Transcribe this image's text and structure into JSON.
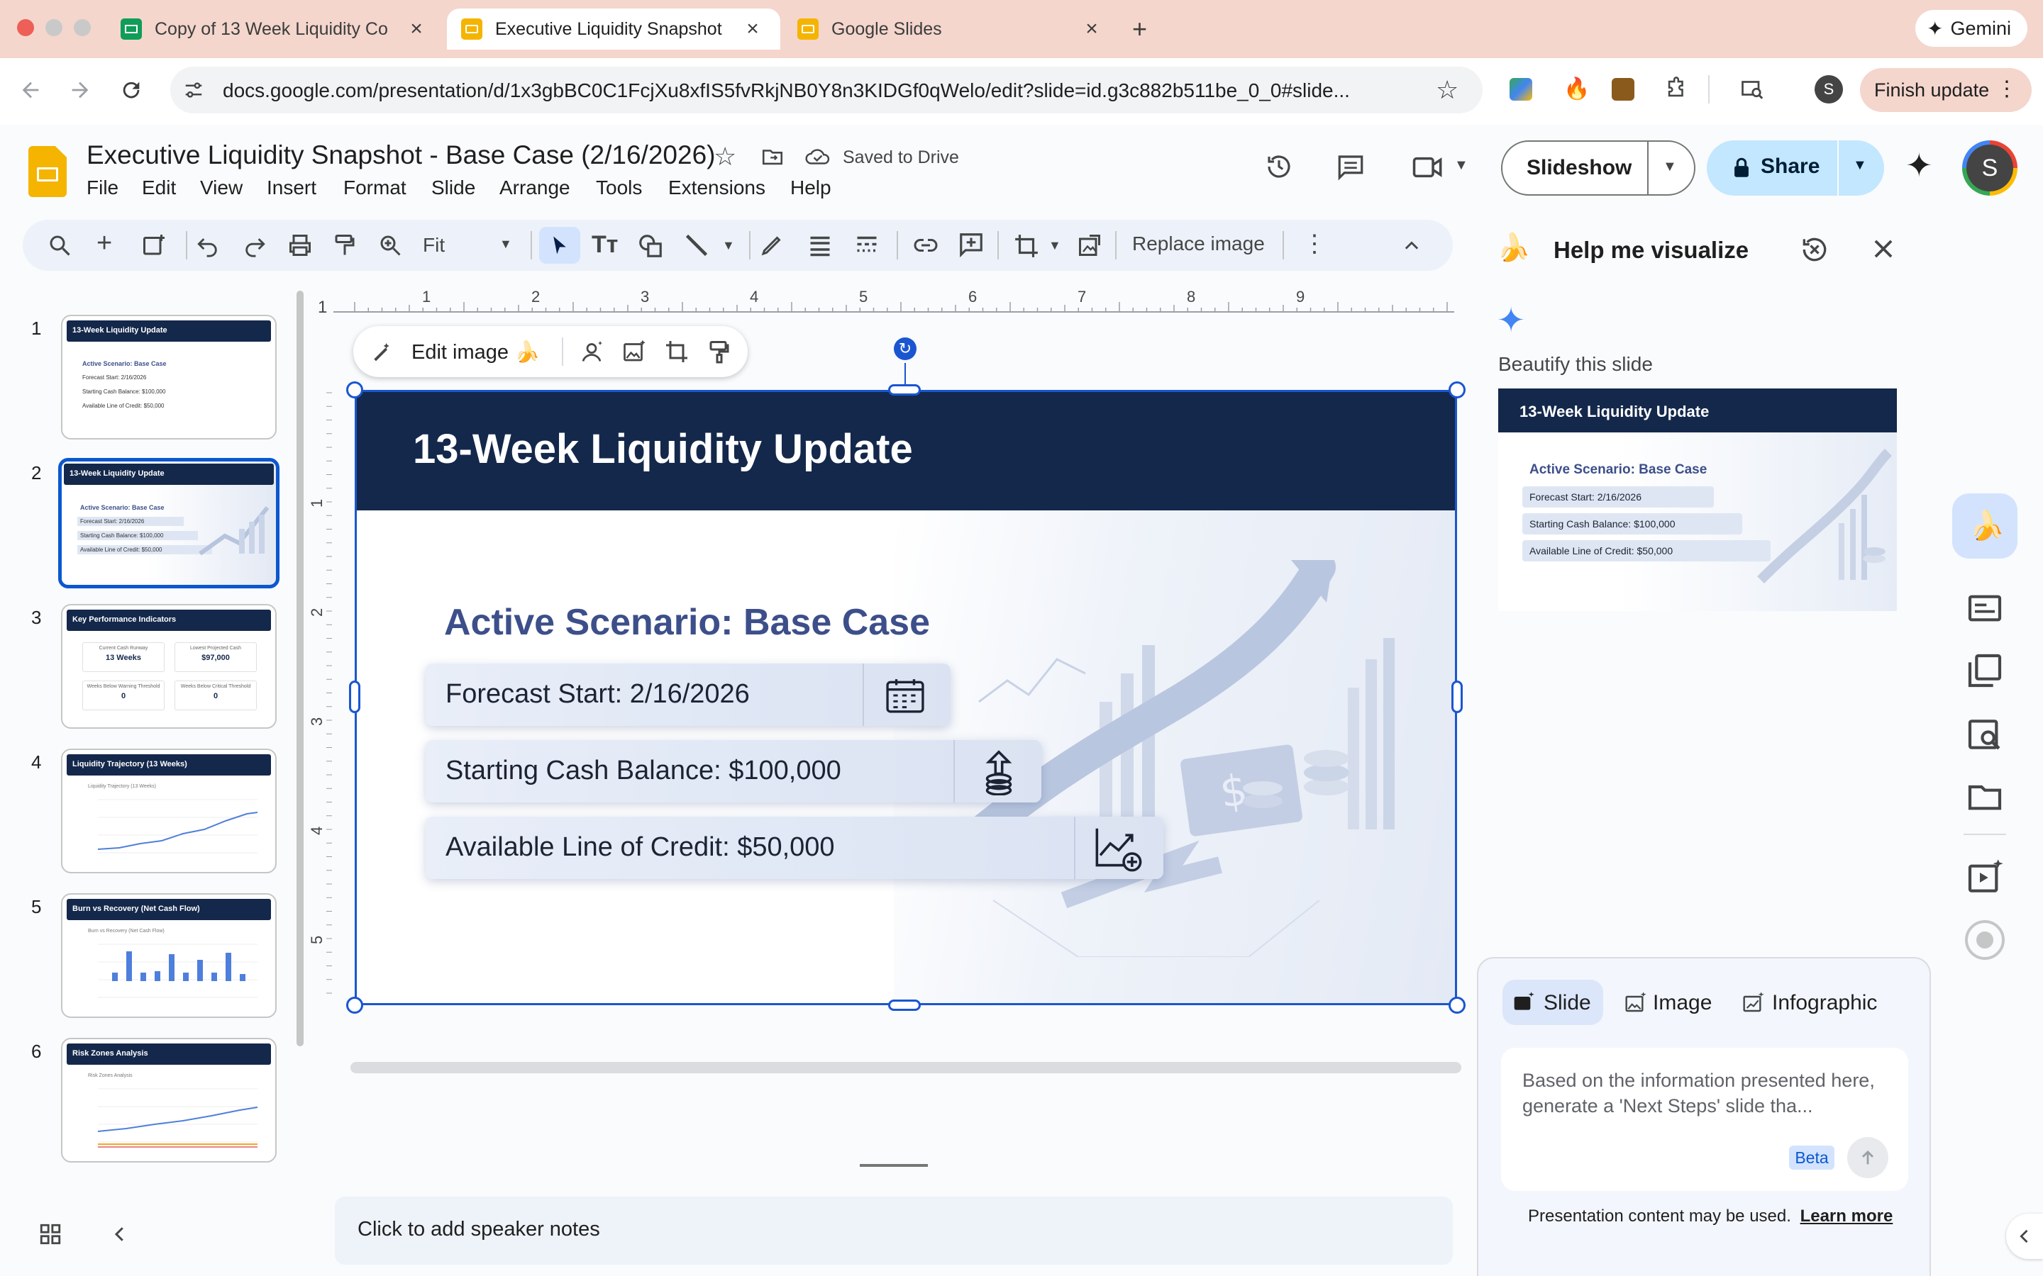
{
  "browser": {
    "tabs": [
      {
        "title": "Copy of 13 Week Liquidity Co",
        "favicon_color": "#0f9d58"
      },
      {
        "title": "Executive Liquidity Snapshot",
        "favicon_color": "#f4b400"
      },
      {
        "title": "Google Slides",
        "favicon_color": "#f4b400"
      }
    ],
    "gemini_label": "Gemini",
    "url": "docs.google.com/presentation/d/1x3gbBC0C1FcjXu8xfIS5fvRkjNB0Y8n3KIDGf0qWelo/edit?slide=id.g3c882b511be_0_0#slide...",
    "profile_initial": "S",
    "finish_update": "Finish update"
  },
  "doc": {
    "title": "Executive Liquidity Snapshot - Base Case (2/16/2026)",
    "saved_status": "Saved to Drive",
    "menus": [
      "File",
      "Edit",
      "View",
      "Insert",
      "Format",
      "Slide",
      "Arrange",
      "Tools",
      "Extensions",
      "Help"
    ],
    "slideshow_label": "Slideshow",
    "share_label": "Share",
    "avatar_initial": "S"
  },
  "toolbar": {
    "zoom": "Fit",
    "replace_image": "Replace image"
  },
  "ruler": {
    "h_ticks": [
      "1",
      "2",
      "3",
      "4",
      "5",
      "6",
      "7",
      "8",
      "9"
    ],
    "v_ticks": [
      "1",
      "2",
      "3",
      "4",
      "5"
    ]
  },
  "floating": {
    "edit_image": "Edit image 🍌"
  },
  "slides": [
    {
      "num": "1",
      "title": "13-Week Liquidity Update",
      "lines": [
        "Active Scenario: Base Case",
        "Forecast Start: 2/16/2026",
        "Starting Cash Balance: $100,000",
        "Available Line of Credit: $50,000"
      ]
    },
    {
      "num": "2",
      "title": "13-Week Liquidity Update",
      "lines": [
        "Active Scenario: Base Case",
        "Forecast Start: 2/16/2026",
        "Starting Cash Balance: $100,000",
        "Available Line of Credit: $50,000"
      ]
    },
    {
      "num": "3",
      "title": "Key Performance Indicators",
      "lines": [
        "Current Cash Runway",
        "13 Weeks",
        "Lowest Projected Cash",
        "$97,000",
        "Weeks Below Warning Threshold",
        "0",
        "Weeks Below Critical Threshold",
        "0"
      ]
    },
    {
      "num": "4",
      "title": "Liquidity Trajectory (13 Weeks)",
      "lines": [
        "Liquidity Trajectory (13 Weeks)"
      ]
    },
    {
      "num": "5",
      "title": "Burn vs Recovery (Net Cash Flow)",
      "lines": [
        "Burn vs Recovery (Net Cash Flow)"
      ]
    },
    {
      "num": "6",
      "title": "Risk Zones Analysis",
      "lines": [
        "Risk Zones Analysis"
      ]
    }
  ],
  "current_slide": {
    "title": "13-Week Liquidity Update",
    "subtitle": "Active Scenario: Base Case",
    "items": [
      "Forecast Start: 2/16/2026",
      "Starting Cash Balance: $100,000",
      "Available Line of Credit: $50,000"
    ]
  },
  "notes_placeholder": "Click to add speaker notes",
  "panel": {
    "title": "Help me visualize",
    "beautify": "Beautify this slide",
    "preview": {
      "title": "13-Week Liquidity Update",
      "subtitle": "Active Scenario: Base Case",
      "items": [
        "Forecast Start: 2/16/2026",
        "Starting Cash Balance: $100,000",
        "Available Line of Credit: $50,000"
      ]
    },
    "modes": [
      "Slide",
      "Image",
      "Infographic"
    ],
    "prompt_text": "Based on the information presented here, generate a 'Next Steps' slide tha...",
    "beta": "Beta",
    "disclaimer": "Presentation content may be used.",
    "learn_more": "Learn more"
  },
  "colors": {
    "accent": "#0b57d0",
    "slide_header": "#14284b",
    "scenario_text": "#3d4f8a"
  }
}
